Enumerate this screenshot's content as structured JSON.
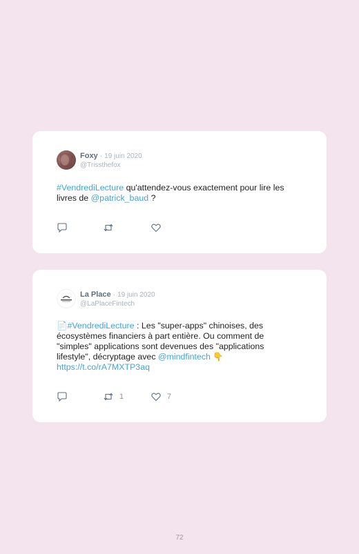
{
  "tweets": [
    {
      "name": "Foxy",
      "dot": "·",
      "date": "19 juin 2020",
      "handle": "@Trissthefox",
      "segments": [
        {
          "text": "#VendrediLecture",
          "highlight": true
        },
        {
          "text": " qu'attendez-vous exactement pour lire les livres de ",
          "highlight": false
        },
        {
          "text": "@patrick_baud",
          "highlight": true
        },
        {
          "text": " ?",
          "highlight": false
        }
      ],
      "retweet_count": "",
      "like_count": ""
    },
    {
      "name": "La Place",
      "dot": "·",
      "date": "19 juin 2020",
      "handle": "@LaPlaceFintech",
      "segments": [
        {
          "text": "📄",
          "highlight": false
        },
        {
          "text": "#VendrediLecture",
          "highlight": true
        },
        {
          "text": " : Les \"super-apps\" chinoises, des écosystèmes financiers à part entière. Ou comment de \"simples\" applications sont devenues des \"applications lifestyle\", décryptage avec ",
          "highlight": false
        },
        {
          "text": "@mindfintech",
          "highlight": true
        },
        {
          "text": " 👇 ",
          "highlight": false
        },
        {
          "text": "https://t.co/rA7MXTP3aq",
          "highlight": true
        }
      ],
      "retweet_count": "1",
      "like_count": "7"
    }
  ],
  "icons": {
    "reply": "reply-icon",
    "retweet": "retweet-icon",
    "like": "heart-icon"
  },
  "colors": {
    "background": "#f3e4ee",
    "card": "#ffffff",
    "link": "#3ea6da",
    "name": "#5d6d7e",
    "muted": "#aab3bc"
  },
  "page_number": "72"
}
